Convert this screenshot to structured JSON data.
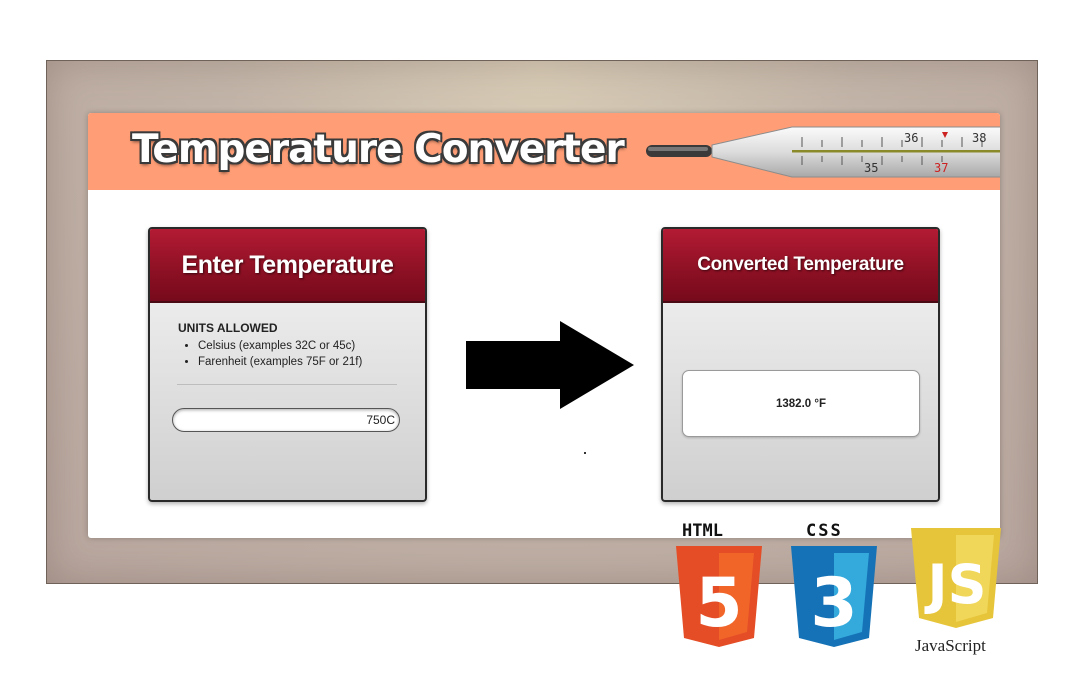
{
  "app": {
    "title": "Temperature Converter"
  },
  "thermometer": {
    "top_scale": [
      "36",
      "38"
    ],
    "bottom_scale": [
      "35",
      "37"
    ]
  },
  "input_panel": {
    "heading": "Enter Temperature",
    "units_title": "UNITS ALLOWED",
    "units": [
      "Celsius (examples 32C or 45c)",
      "Farenheit (examples 75F or 21f)"
    ],
    "input_value": "750C"
  },
  "output_panel": {
    "heading": "Converted Temperature",
    "result": "1382.0 °F"
  },
  "logos": {
    "html_label": "HTML",
    "html_glyph": "5",
    "css_label": "CSS",
    "css_glyph": "3",
    "js_glyph": "JS",
    "js_label": "JavaScript"
  },
  "colors": {
    "header_bg": "#ff9e76",
    "panel_head": "#8c1023",
    "html5_orange": "#e44d26",
    "css3_blue": "#1572b6",
    "js_yellow": "#e7c53a"
  }
}
